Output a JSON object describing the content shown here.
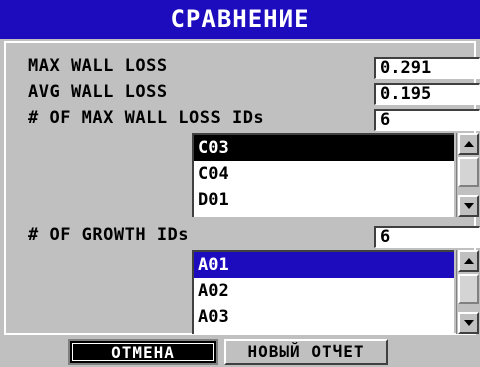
{
  "title": "СРАВНЕНИЕ",
  "rows": {
    "max_wall_loss": {
      "label": "MAX WALL LOSS",
      "value": "0.291"
    },
    "avg_wall_loss": {
      "label": "AVG WALL LOSS",
      "value": "0.195"
    },
    "max_wall_loss_ids": {
      "label": "# OF MAX WALL LOSS IDs",
      "value": "6"
    },
    "growth_ids": {
      "label": "# OF GROWTH IDs",
      "value": "6"
    }
  },
  "max_loss_list": {
    "items": [
      "C03",
      "C04",
      "D01"
    ],
    "selected_index": 0
  },
  "growth_list": {
    "items": [
      "A01",
      "A02",
      "A03"
    ],
    "selected_index": 0
  },
  "buttons": {
    "cancel": "ОТМЕНА",
    "new_report": "НОВЫЙ ОТЧЕТ"
  },
  "colors": {
    "title_bg": "#1c0cbe",
    "selection_blue": "#1c0cbe",
    "panel_bg": "#c0c0c0"
  }
}
